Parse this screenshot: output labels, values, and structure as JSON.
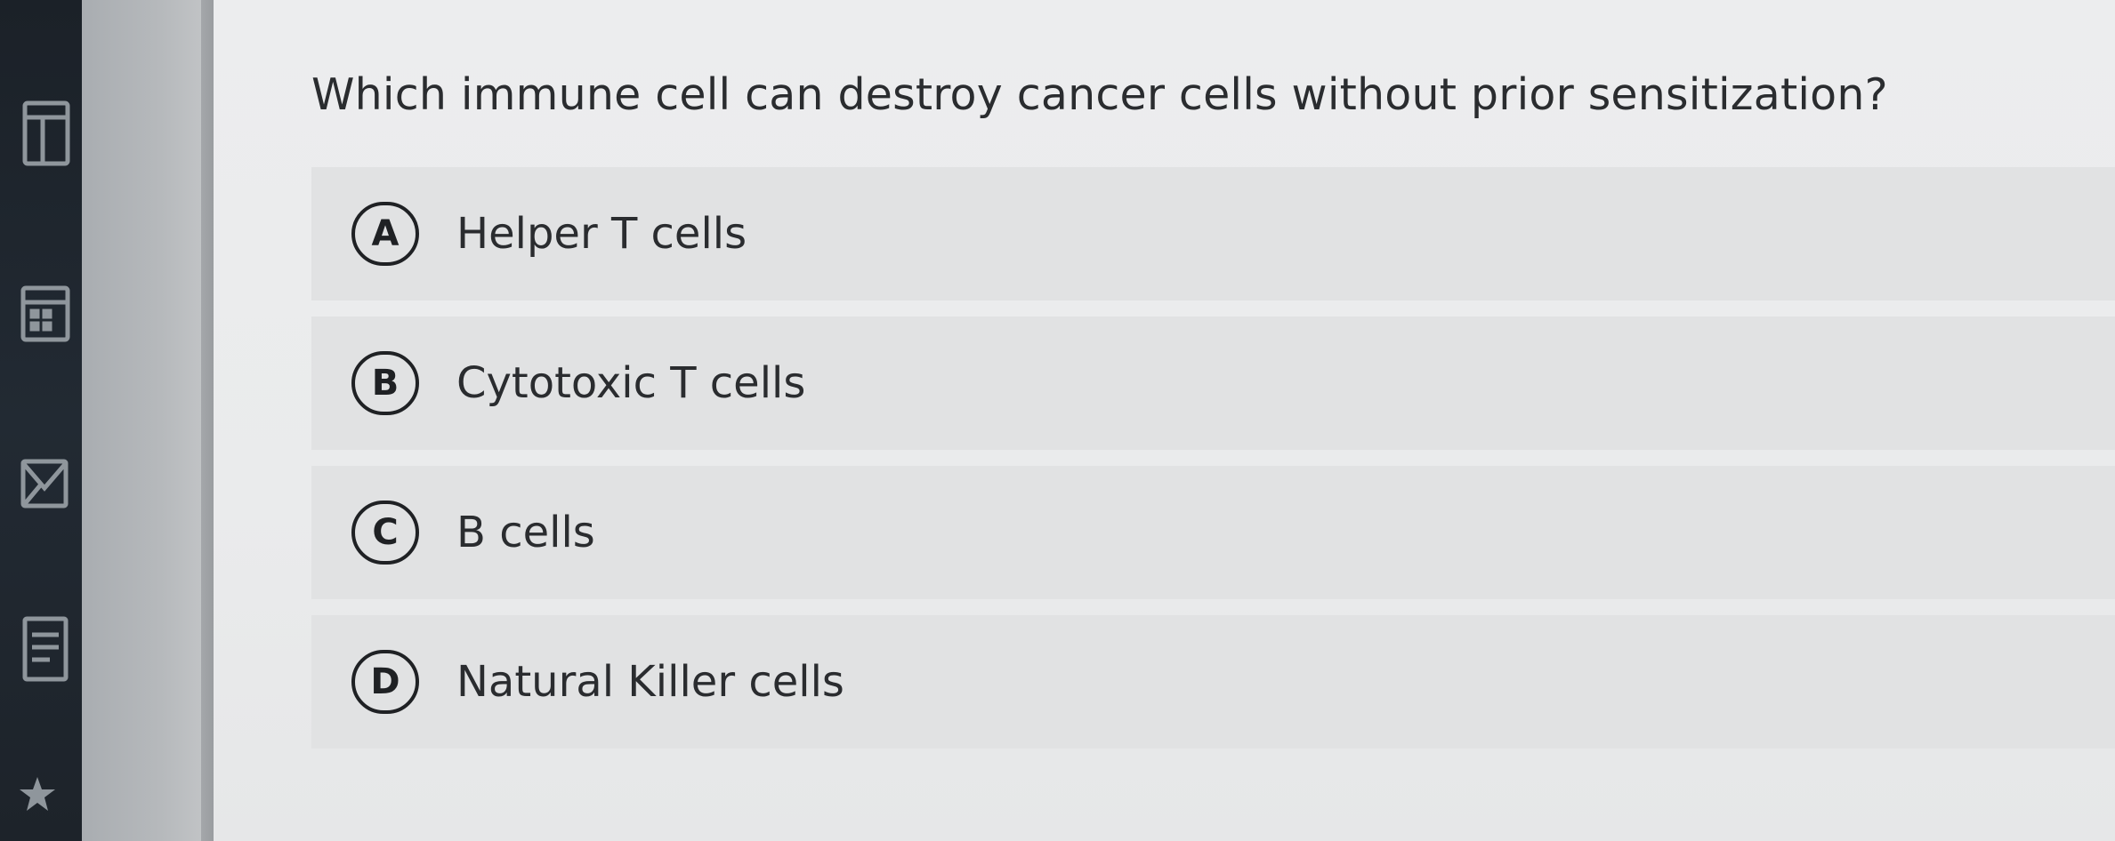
{
  "question": {
    "text": "Which immune cell can destroy cancer cells without prior sensitization?"
  },
  "options": [
    {
      "letter": "A",
      "label": "Helper T cells"
    },
    {
      "letter": "B",
      "label": "Cytotoxic T cells"
    },
    {
      "letter": "C",
      "label": "B cells"
    },
    {
      "letter": "D",
      "label": "Natural Killer cells"
    }
  ],
  "rail": {
    "icons": [
      "layout-icon",
      "calendar-icon",
      "mail-icon",
      "document-icon",
      "star-icon"
    ]
  },
  "colors": {
    "rail": "#1f262e",
    "sidebar": "#b3b6b9",
    "option_background": "#e1e2e3",
    "text": "#2a2c2f"
  }
}
